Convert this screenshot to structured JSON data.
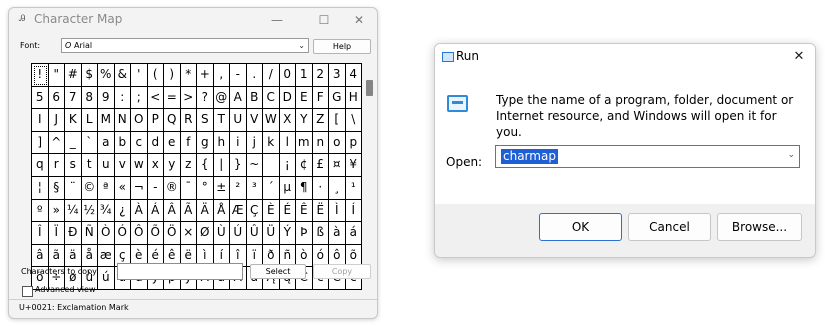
{
  "charmap": {
    "title": "Character Map",
    "controls": {
      "minimize": "—",
      "maximize": "☐",
      "close": "✕"
    },
    "font_label": "Font:",
    "font_value": "Arial",
    "font_icon_glyph": "O",
    "help_label": "Help",
    "grid_chars": [
      "!",
      "\"",
      "#",
      "$",
      "%",
      "&",
      "'",
      "(",
      ")",
      "*",
      "+",
      ",",
      "-",
      ".",
      "/",
      "0",
      "1",
      "2",
      "3",
      "4",
      "5",
      "6",
      "7",
      "8",
      "9",
      ":",
      ";",
      "<",
      "=",
      ">",
      "?",
      "@",
      "A",
      "B",
      "C",
      "D",
      "E",
      "F",
      "G",
      "H",
      "I",
      "J",
      "K",
      "L",
      "M",
      "N",
      "O",
      "P",
      "Q",
      "R",
      "S",
      "T",
      "U",
      "V",
      "W",
      "X",
      "Y",
      "Z",
      "[",
      "\\",
      "]",
      "^",
      "_",
      "`",
      "a",
      "b",
      "c",
      "d",
      "e",
      "f",
      "g",
      "h",
      "i",
      "j",
      "k",
      "l",
      "m",
      "n",
      "o",
      "p",
      "q",
      "r",
      "s",
      "t",
      "u",
      "v",
      "w",
      "x",
      "y",
      "z",
      "{",
      "|",
      "}",
      "~",
      " ",
      "¡",
      "¢",
      "£",
      "¤",
      "¥",
      "¦",
      "§",
      "¨",
      "©",
      "ª",
      "«",
      "¬",
      "-",
      "®",
      "¯",
      "°",
      "±",
      "²",
      "³",
      "´",
      "µ",
      "¶",
      "·",
      "¸",
      "¹",
      "º",
      "»",
      "¼",
      "½",
      "¾",
      "¿",
      "À",
      "Á",
      "Â",
      "Ã",
      "Ä",
      "Å",
      "Æ",
      "Ç",
      "È",
      "É",
      "Ê",
      "Ë",
      "Ì",
      "Í",
      "Î",
      "Ï",
      "Ð",
      "Ñ",
      "Ò",
      "Ó",
      "Ô",
      "Õ",
      "Ö",
      "×",
      "Ø",
      "Ù",
      "Ú",
      "Û",
      "Ü",
      "Ý",
      "Þ",
      "ß",
      "à",
      "á",
      "â",
      "ã",
      "ä",
      "å",
      "æ",
      "ç",
      "è",
      "é",
      "ê",
      "ë",
      "ì",
      "í",
      "î",
      "ï",
      "ð",
      "ñ",
      "ò",
      "ó",
      "ô",
      "õ",
      "ö",
      "÷",
      "ø",
      "ù",
      "ú",
      "û",
      "ü",
      "ý",
      "þ",
      "ÿ",
      "Ā",
      "ā",
      "Ă",
      "ă",
      "Ą",
      "ą",
      "Ć",
      "ć",
      "Ĉ",
      "ĉ"
    ],
    "selected_index": 0,
    "copy_label": "Characters to copy:",
    "copy_value": "",
    "select_label": "Select",
    "copy_btn_label": "Copy",
    "advanced_label": "Advanced view",
    "advanced_checked": false,
    "status": "U+0021: Exclamation Mark"
  },
  "run": {
    "title": "Run",
    "close_glyph": "✕",
    "description": "Type the name of a program, folder, document or Internet resource, and Windows will open it for you.",
    "open_label": "Open:",
    "open_value": "charmap",
    "ok_label": "OK",
    "cancel_label": "Cancel",
    "browse_label": "Browse..."
  }
}
